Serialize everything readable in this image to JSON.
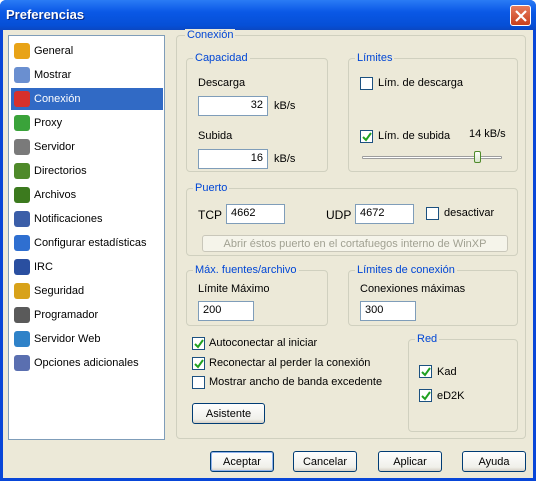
{
  "window": {
    "title": "Preferencias"
  },
  "sidebar": {
    "items": [
      {
        "label": "General",
        "icon": "general-icon",
        "color": "#e8a317"
      },
      {
        "label": "Mostrar",
        "icon": "display-icon",
        "color": "#6a8fd0"
      },
      {
        "label": "Conexión",
        "icon": "connection-icon",
        "color": "#d6302c"
      },
      {
        "label": "Proxy",
        "icon": "proxy-icon",
        "color": "#3aa33a"
      },
      {
        "label": "Servidor",
        "icon": "server-icon",
        "color": "#7a7a7a"
      },
      {
        "label": "Directorios",
        "icon": "folder-icon",
        "color": "#4f8a2a"
      },
      {
        "label": "Archivos",
        "icon": "files-icon",
        "color": "#3c7a1e"
      },
      {
        "label": "Notificaciones",
        "icon": "notifications-icon",
        "color": "#3b5ea8"
      },
      {
        "label": "Configurar estadísticas",
        "icon": "stats-icon",
        "color": "#2f6fd0"
      },
      {
        "label": "IRC",
        "icon": "irc-icon",
        "color": "#2a4fa0"
      },
      {
        "label": "Seguridad",
        "icon": "lock-icon",
        "color": "#d8a21a"
      },
      {
        "label": "Programador",
        "icon": "clock-icon",
        "color": "#5a5a5a"
      },
      {
        "label": "Servidor Web",
        "icon": "globe-icon",
        "color": "#2f82c8"
      },
      {
        "label": "Opciones adicionales",
        "icon": "options-icon",
        "color": "#5a6fb0"
      }
    ],
    "selected_index": 2
  },
  "panel": {
    "title": "Conexión",
    "capacidad": {
      "title": "Capacidad",
      "descarga_label": "Descarga",
      "descarga_value": "32",
      "subida_label": "Subida",
      "subida_value": "16",
      "unit": "kB/s"
    },
    "limites": {
      "title": "Límites",
      "lim_descarga_label": "Lím. de descarga",
      "lim_descarga_checked": false,
      "lim_subida_label": "Lím. de subida",
      "lim_subida_checked": true,
      "lim_subida_value": "14 kB/s"
    },
    "puerto": {
      "title": "Puerto",
      "tcp_label": "TCP",
      "tcp_value": "4662",
      "udp_label": "UDP",
      "udp_value": "4672",
      "desactivar_label": "desactivar",
      "firewall_button": "Abrir éstos puerto en el cortafuegos interno de WinXP"
    },
    "fuentes": {
      "title": "Máx. fuentes/archivo",
      "limite_label": "Límite Máximo",
      "limite_value": "200"
    },
    "conexion_limits": {
      "title": "Límites de conexión",
      "max_label": "Conexiones máximas",
      "max_value": "300"
    },
    "options": [
      {
        "label": "Autoconectar al iniciar",
        "checked": true
      },
      {
        "label": "Reconectar al perder la conexión",
        "checked": true
      },
      {
        "label": "Mostrar ancho de banda excedente",
        "checked": false
      }
    ],
    "red": {
      "title": "Red",
      "kad_label": "Kad",
      "kad_checked": true,
      "ed2k_label": "eD2K",
      "ed2k_checked": true
    },
    "asistente_button": "Asistente"
  },
  "footer": {
    "accept": "Aceptar",
    "cancel": "Cancelar",
    "apply": "Aplicar",
    "help": "Ayuda"
  },
  "colors": {
    "titlebar": "#0a58e6",
    "selection": "#316ac5",
    "group_title": "#0046d5",
    "face": "#ece9d8"
  }
}
